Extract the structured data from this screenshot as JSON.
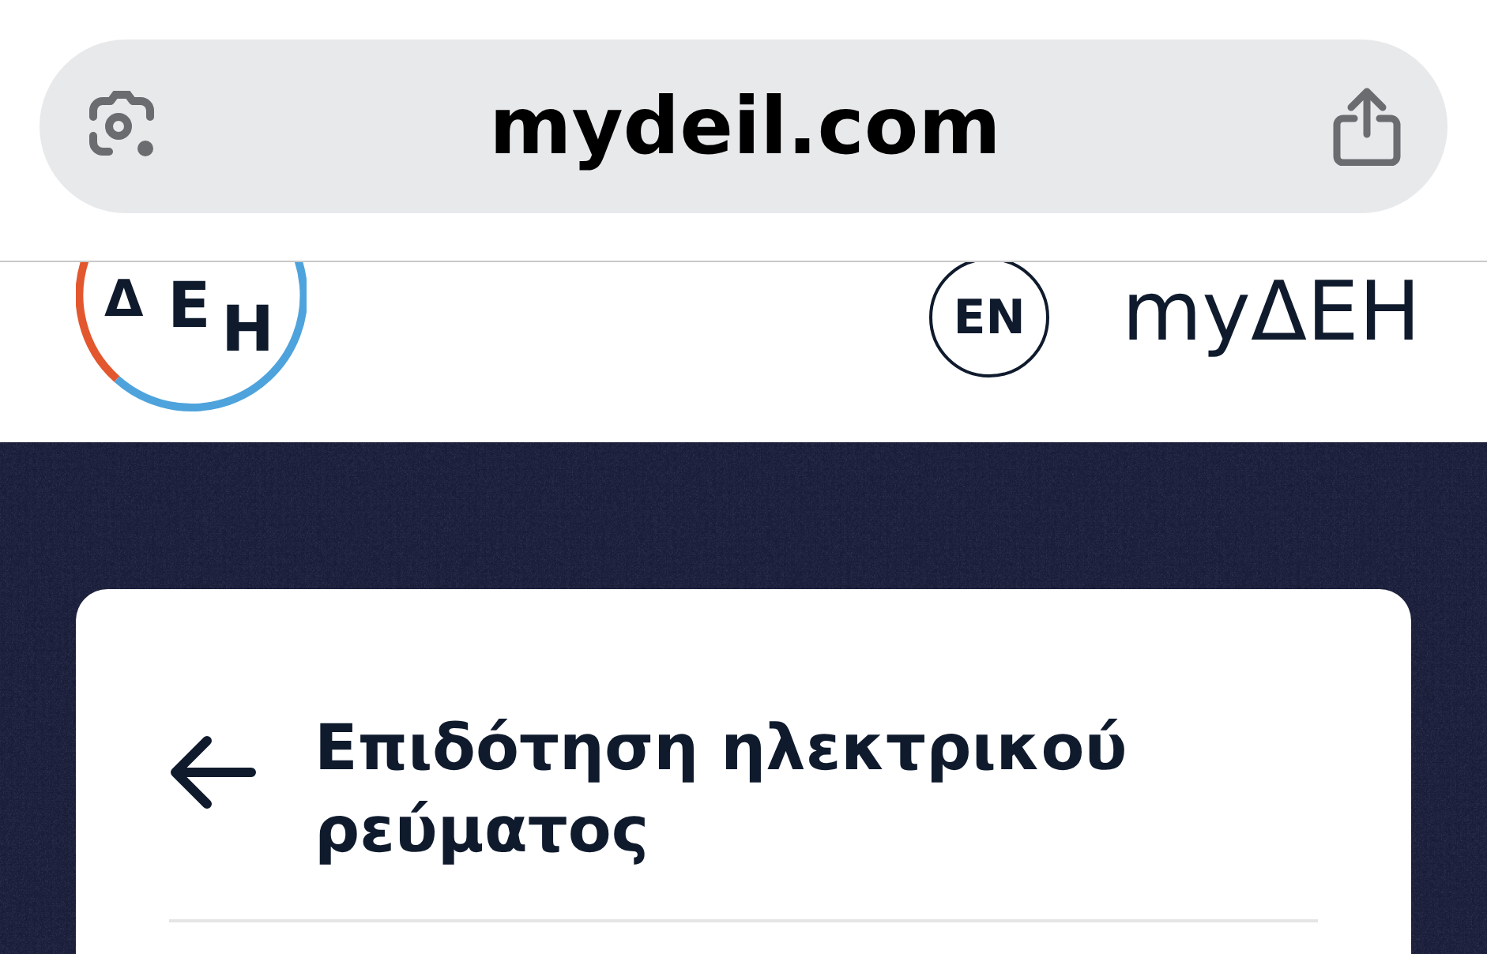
{
  "address_bar": {
    "url": "mydeil.com"
  },
  "header": {
    "logo_letters": [
      "Δ",
      "Ε",
      "Η"
    ],
    "language_button": "EN",
    "brand_link": "myΔΕΗ"
  },
  "card": {
    "title_lines": [
      "Επιδότηση ηλεκτρικού",
      "ρεύματος"
    ]
  }
}
